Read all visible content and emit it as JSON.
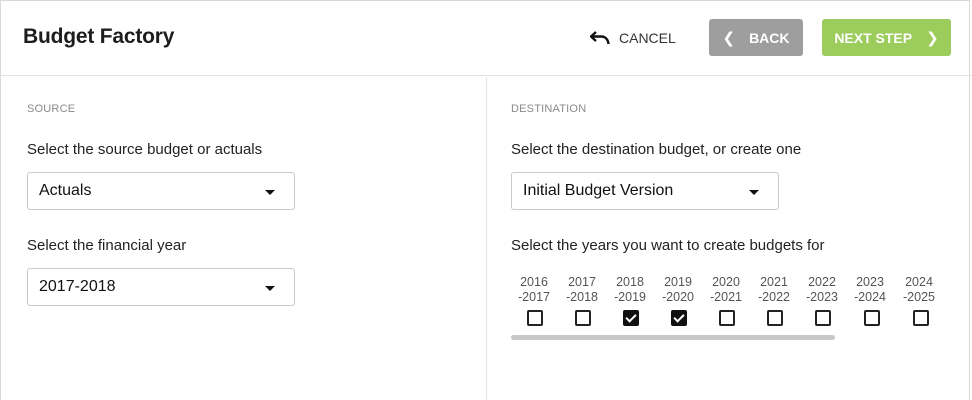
{
  "header": {
    "title": "Budget Factory",
    "cancel_label": "CANCEL",
    "back_label": "BACK",
    "next_label": "NEXT STEP"
  },
  "source": {
    "section_label": "SOURCE",
    "budget_prompt": "Select the source budget or actuals",
    "budget_value": "Actuals",
    "year_prompt": "Select the financial year",
    "year_value": "2017-2018"
  },
  "destination": {
    "section_label": "DESTINATION",
    "budget_prompt": "Select the destination budget, or create one",
    "budget_value": "Initial Budget Version",
    "years_prompt": "Select the years you want to create budgets for",
    "years": [
      {
        "line1": "2016",
        "line2": "-2017",
        "checked": false
      },
      {
        "line1": "2017",
        "line2": "-2018",
        "checked": false
      },
      {
        "line1": "2018",
        "line2": "-2019",
        "checked": true
      },
      {
        "line1": "2019",
        "line2": "-2020",
        "checked": true
      },
      {
        "line1": "2020",
        "line2": "-2021",
        "checked": false
      },
      {
        "line1": "2021",
        "line2": "-2022",
        "checked": false
      },
      {
        "line1": "2022",
        "line2": "-2023",
        "checked": false
      },
      {
        "line1": "2023",
        "line2": "-2024",
        "checked": false
      },
      {
        "line1": "2024",
        "line2": "-2025",
        "checked": false
      }
    ]
  },
  "icons": {
    "cancel": "undo-arrow-icon",
    "back": "chevron-left-icon",
    "next": "chevron-right-icon",
    "dropdown": "caret-down-icon"
  },
  "colors": {
    "back_button": "#9e9e9e",
    "next_button": "#9ccc5c"
  }
}
